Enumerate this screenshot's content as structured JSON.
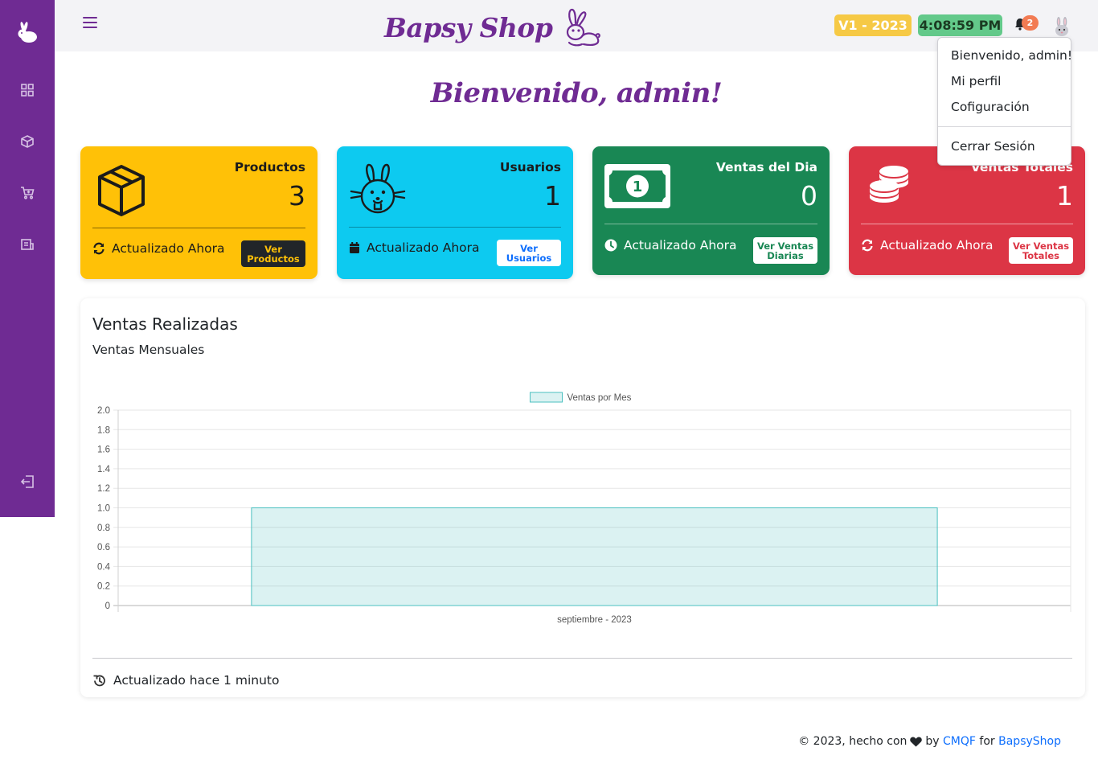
{
  "sidebar": {
    "items": [
      {
        "icon": "rabbit-logo-icon"
      },
      {
        "icon": "dashboard-icon"
      },
      {
        "icon": "box-icon"
      },
      {
        "icon": "cart-icon"
      },
      {
        "icon": "report-icon"
      },
      {
        "icon": "logout-icon"
      }
    ]
  },
  "header": {
    "brand": "Bapsy Shop",
    "version": "V1 - 2023",
    "clock": "4:08:59 PM",
    "notifications": "2"
  },
  "dropdown": {
    "greeting": "Bienvenido, admin!",
    "profile": "Mi perfil",
    "settings": "Cofiguración",
    "logout": "Cerrar Sesión"
  },
  "main": {
    "welcome": "Bienvenido, admin!"
  },
  "cards": {
    "products": {
      "title": "Productos",
      "value": "3",
      "footer": "Actualizado Ahora",
      "button": "Ver Productos",
      "color": "#ffc107"
    },
    "users": {
      "title": "Usuarios",
      "value": "1",
      "footer": "Actualizado Ahora",
      "button": "Ver Usuarios",
      "color": "#0dcaf0"
    },
    "daily_sales": {
      "title": "Ventas del Dia",
      "value": "0",
      "footer": "Actualizado Ahora",
      "button": "Ver Ventas Diarias",
      "color": "#198754"
    },
    "total_sales": {
      "title": "Ventas Totales",
      "value": "1",
      "footer": "Actualizado Ahora",
      "button": "Ver Ventas Totales",
      "color": "#dc3545"
    }
  },
  "chart_section": {
    "title": "Ventas Realizadas",
    "subtitle": "Ventas Mensuales",
    "updated": "Actualizado hace 1 minuto"
  },
  "chart_data": {
    "type": "bar",
    "categories": [
      "septiembre - 2023"
    ],
    "series": [
      {
        "name": "Ventas por Mes",
        "values": [
          1
        ],
        "color": "#4bc0c0"
      }
    ],
    "ylim": [
      0,
      2
    ],
    "yticks": [
      "0",
      "0.2",
      "0.4",
      "0.6",
      "0.8",
      "1.0",
      "1.2",
      "1.4",
      "1.6",
      "1.8",
      "2.0"
    ],
    "grid": true,
    "legend": "top-center"
  },
  "footer": {
    "prefix": "© 2023, hecho con",
    "by": "by",
    "author": "CMQF",
    "for": "for",
    "project": "BapsyShop"
  }
}
